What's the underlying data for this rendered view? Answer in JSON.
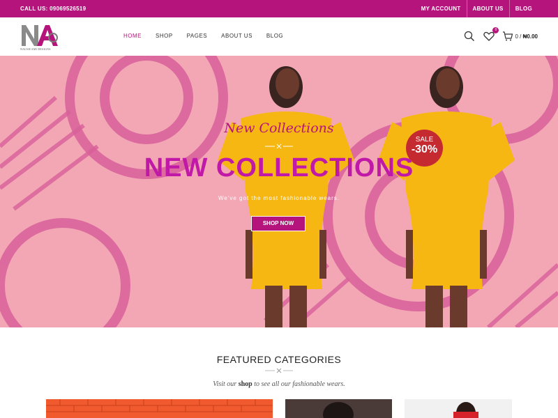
{
  "topbar": {
    "call": "CALL US: 09069526519",
    "links": [
      "MY ACCOUNT",
      "ABOUT US",
      "BLOG"
    ]
  },
  "header": {
    "logo_text": "NAUSH AMI DESIGNS",
    "nav": [
      "HOME",
      "SHOP",
      "PAGES",
      "ABOUT US",
      "BLOG"
    ],
    "active_nav": "HOME",
    "wishlist_count": "0",
    "cart_count": "0",
    "cart_total": "₦0.00",
    "cart_sep": "/"
  },
  "hero": {
    "script_title": "New Collections",
    "title": "NEW COLLECTIONS",
    "subtitle": "We've got the most fashionable wears.",
    "button": "SHOP NOW",
    "sale_label": "SALE",
    "sale_value": "-30%"
  },
  "featured": {
    "title": "FEATURED CATEGORIES",
    "sub_before": "Visit our ",
    "sub_link": "shop",
    "sub_after": " to see all our fashionable wears."
  },
  "colors": {
    "brand": "#b5147c",
    "hero_title": "#c019a8",
    "sale": "#c42a30"
  },
  "icons": [
    "search-icon",
    "heart-icon",
    "cart-icon"
  ]
}
